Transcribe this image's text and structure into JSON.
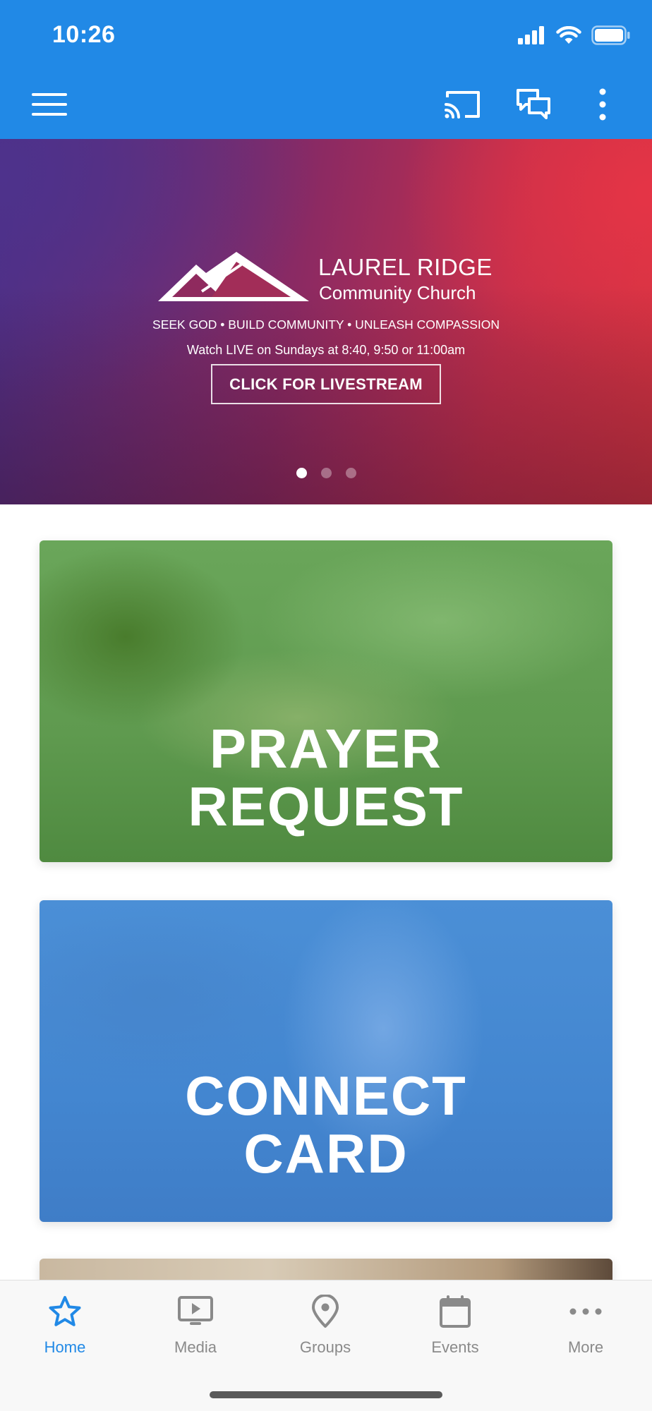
{
  "status_bar": {
    "time": "10:26",
    "icons": [
      "signal-icon",
      "wifi-icon",
      "battery-icon"
    ]
  },
  "app_bar": {
    "menu_icon": "menu-icon",
    "actions": [
      "cast-icon",
      "chat-icon",
      "more-vertical-icon"
    ],
    "background": "#2189e6"
  },
  "hero": {
    "church_name": "LAUREL RIDGE",
    "church_subtitle": "Community Church",
    "tagline": "SEEK GOD  •  BUILD COMMUNITY  •  UNLEASH COMPASSION",
    "watch_line": "Watch LIVE on Sundays at 8:40, 9:50 or 11:00am",
    "button_label": "CLICK FOR LIVESTREAM",
    "carousel_pages": 3,
    "active_page": 1
  },
  "cards": [
    {
      "title_line1": "PRAYER",
      "title_line2": "REQUEST",
      "tint": "#5f9a4f"
    },
    {
      "title_line1": "CONNECT",
      "title_line2": "CARD",
      "tint": "#4386d0"
    }
  ],
  "tab_bar": {
    "tabs": [
      {
        "label": "Home",
        "icon": "star-icon",
        "active": true
      },
      {
        "label": "Media",
        "icon": "media-play-icon",
        "active": false
      },
      {
        "label": "Groups",
        "icon": "location-pin-icon",
        "active": false
      },
      {
        "label": "Events",
        "icon": "calendar-icon",
        "active": false
      },
      {
        "label": "More",
        "icon": "more-horizontal-icon",
        "active": false
      }
    ],
    "active_color": "#2189e6",
    "inactive_color": "#8a8a8a"
  }
}
